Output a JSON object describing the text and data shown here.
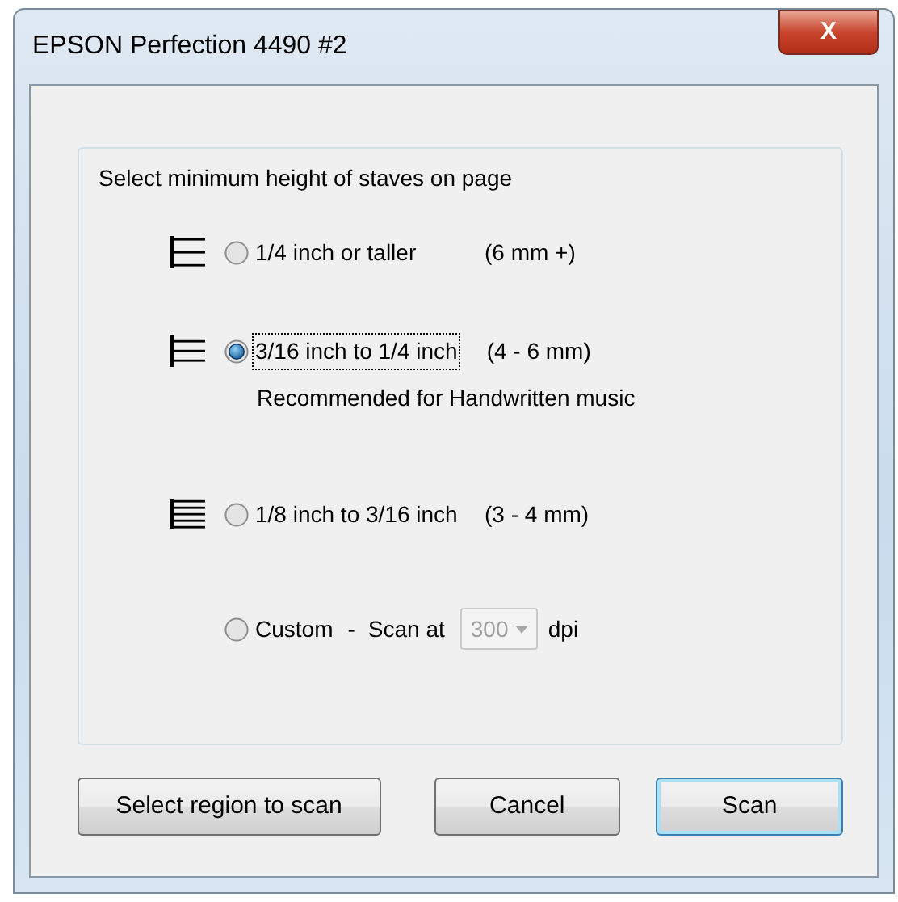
{
  "window": {
    "title": "EPSON Perfection 4490 #2",
    "close": "X"
  },
  "group": {
    "caption": "Select minimum height of staves on page"
  },
  "options": [
    {
      "kind": "staff",
      "label": "1/4 inch or taller",
      "size": "(6 mm +)",
      "selected": false,
      "focused": false
    },
    {
      "kind": "staff",
      "label": "3/16 inch to 1/4 inch",
      "size": "(4 - 6 mm)",
      "selected": true,
      "focused": true,
      "note": "Recommended for Handwritten music"
    },
    {
      "kind": "staff",
      "label": "1/8 inch to 3/16 inch",
      "size": "(3 - 4 mm)",
      "selected": false,
      "focused": false
    },
    {
      "kind": "custom",
      "label": "Custom",
      "separator": "-",
      "prefix": "Scan at",
      "dropdown": {
        "value": "300",
        "disabled": true
      },
      "unit": "dpi",
      "selected": false,
      "focused": false
    }
  ],
  "buttons": [
    {
      "label": "Select region to scan",
      "default": false
    },
    {
      "label": "Cancel",
      "default": false
    },
    {
      "label": "Scan",
      "default": true
    }
  ]
}
